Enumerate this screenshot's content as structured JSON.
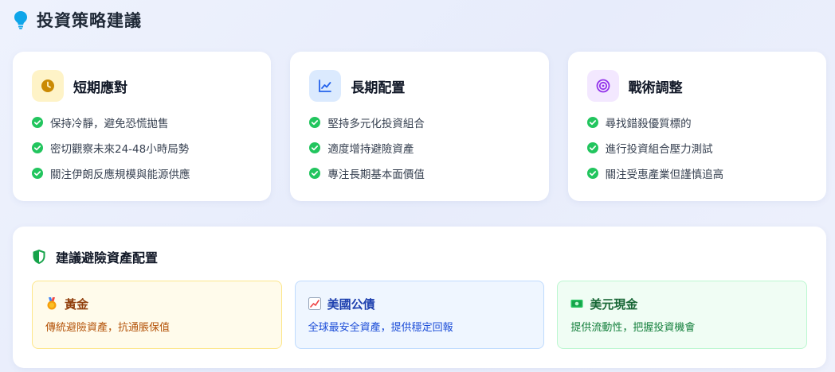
{
  "header": {
    "title": "投資策略建議",
    "icon": "lightbulb-icon",
    "accent": "#0ea5e9"
  },
  "strategies": [
    {
      "title": "短期應對",
      "icon": "clock-icon",
      "icon_color": "#ca8a04",
      "items": [
        "保持冷靜，避免恐慌拋售",
        "密切觀察未來24-48小時局勢",
        "關注伊朗反應規模與能源供應"
      ]
    },
    {
      "title": "長期配置",
      "icon": "chart-line-icon",
      "icon_color": "#2563eb",
      "items": [
        "堅持多元化投資組合",
        "適度增持避險資產",
        "專注長期基本面價值"
      ]
    },
    {
      "title": "戰術調整",
      "icon": "target-icon",
      "icon_color": "#9333ea",
      "items": [
        "尋找錯殺優質標的",
        "進行投資組合壓力測試",
        "關注受惠產業但謹慎追高"
      ]
    }
  ],
  "check_color": "#22c55e",
  "hedge": {
    "title": "建議避險資產配置",
    "icon": "shield-icon",
    "icon_color": "#16a34a",
    "assets": [
      {
        "name": "黃金",
        "icon": "medal-icon",
        "desc": "傳統避險資產，抗通脹保值"
      },
      {
        "name": "美國公債",
        "icon": "chart-increasing-icon",
        "desc": "全球最安全資產，提供穩定回報"
      },
      {
        "name": "美元現金",
        "icon": "dollar-banknote-icon",
        "desc": "提供流動性，把握投資機會"
      }
    ]
  }
}
